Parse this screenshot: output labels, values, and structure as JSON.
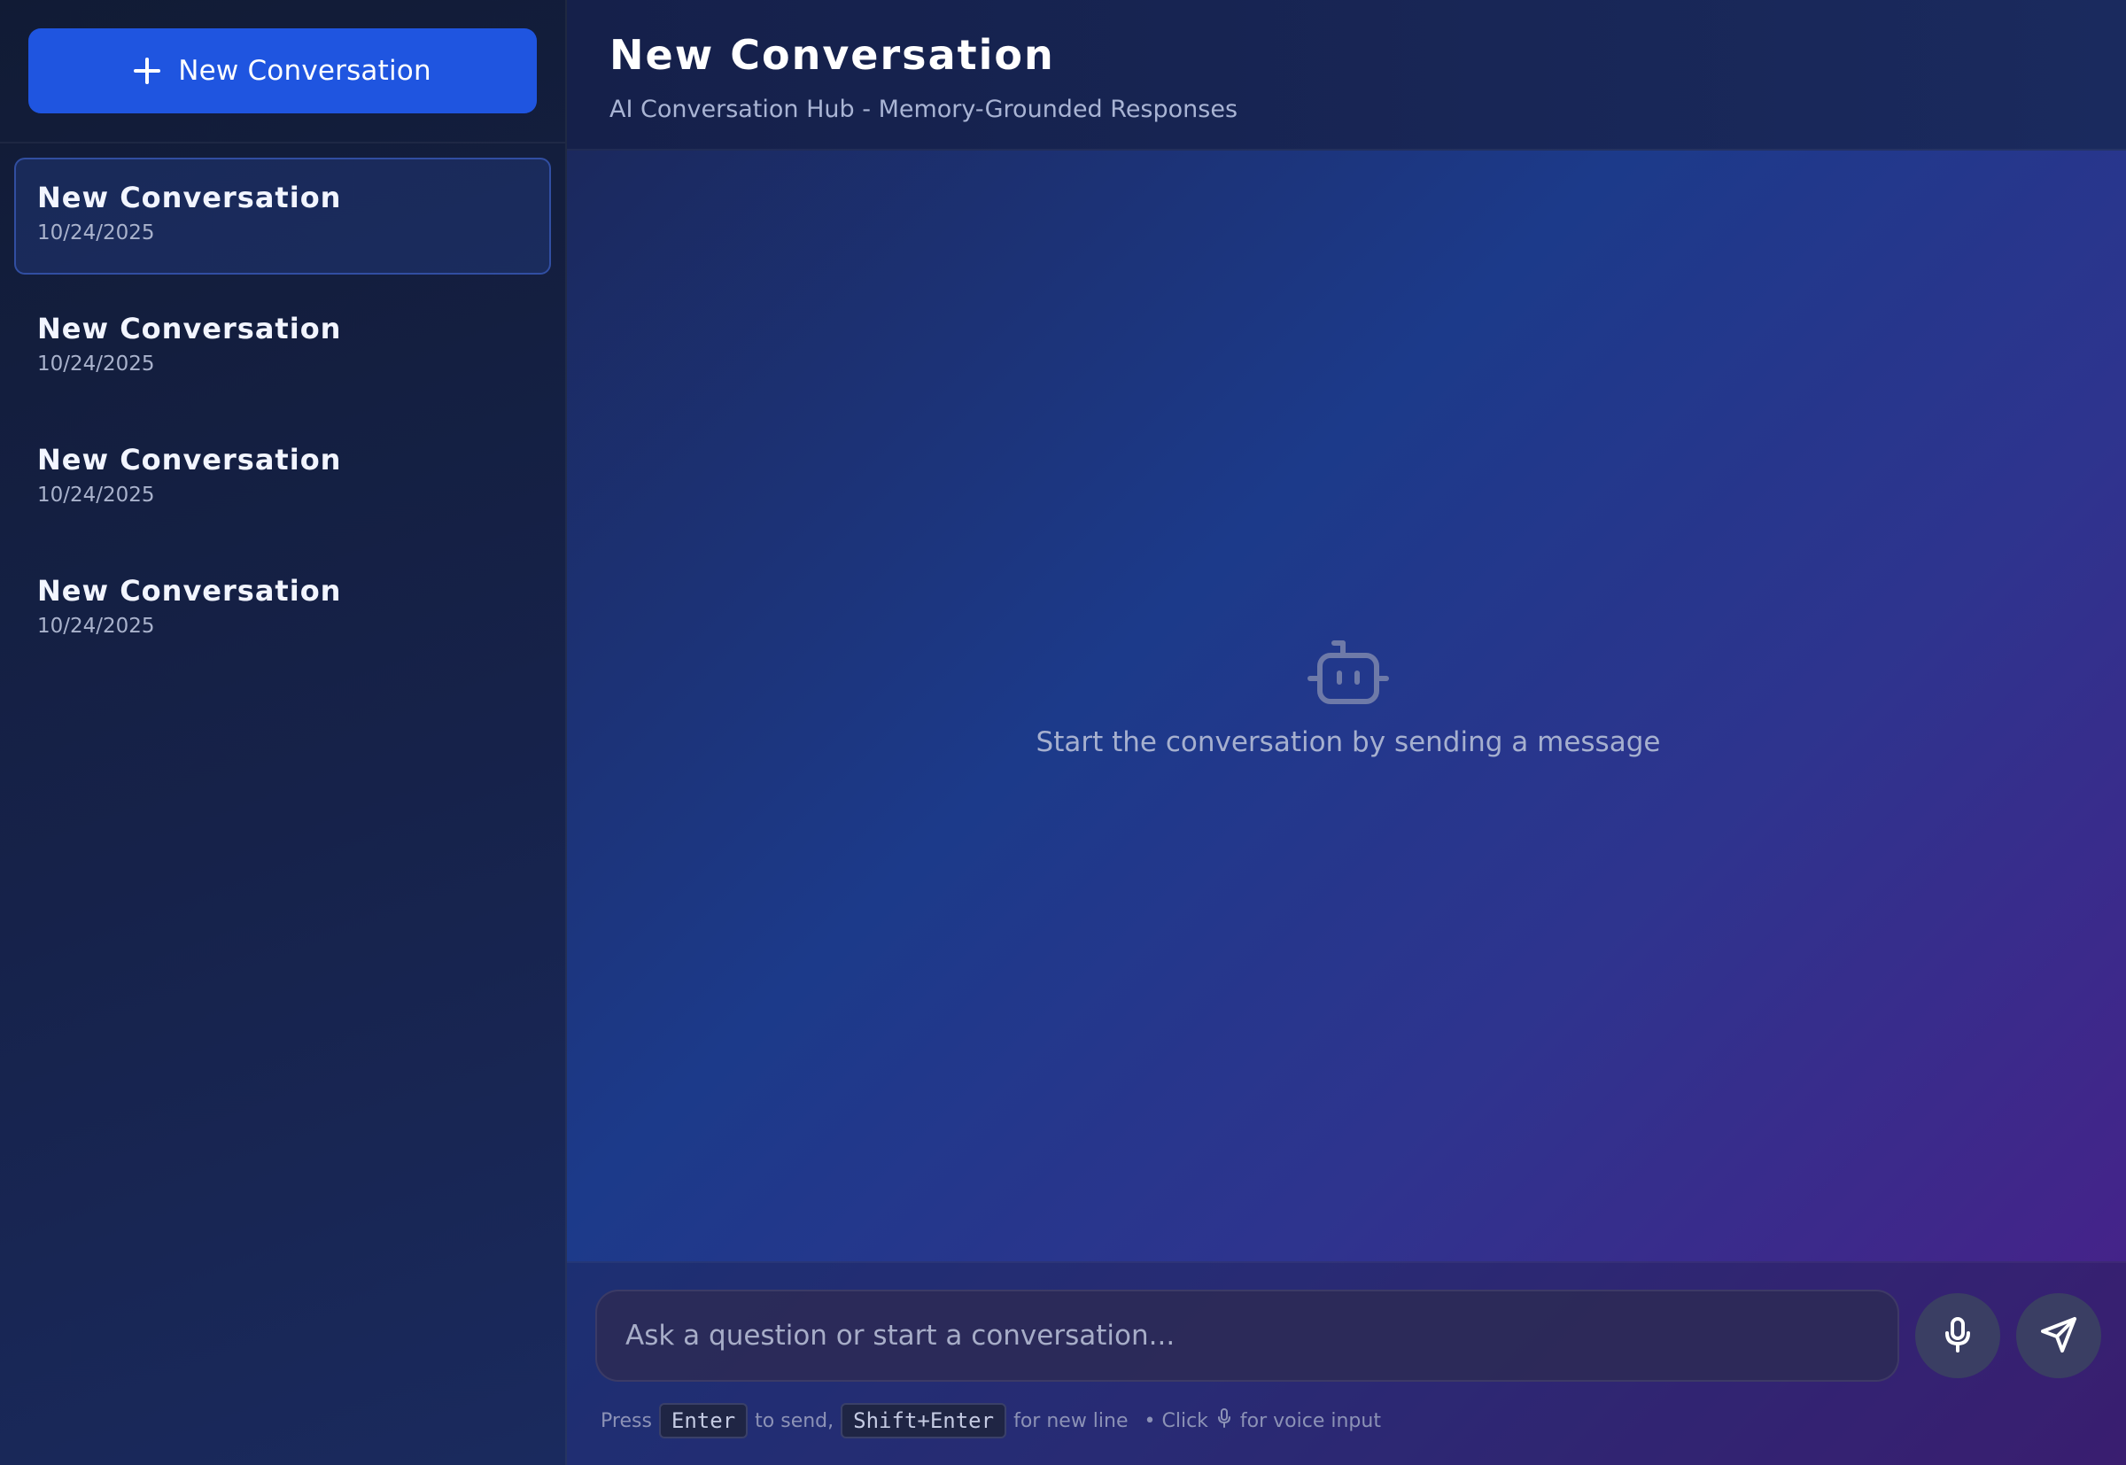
{
  "sidebar": {
    "new_button_label": "New Conversation",
    "items": [
      {
        "title": "New Conversation",
        "date": "10/24/2025",
        "active": true
      },
      {
        "title": "New Conversation",
        "date": "10/24/2025",
        "active": false
      },
      {
        "title": "New Conversation",
        "date": "10/24/2025",
        "active": false
      },
      {
        "title": "New Conversation",
        "date": "10/24/2025",
        "active": false
      }
    ]
  },
  "header": {
    "title": "New Conversation",
    "subtitle": "AI Conversation Hub - Memory-Grounded Responses"
  },
  "chat": {
    "empty_icon": "bot-icon",
    "empty_text": "Start the conversation by sending a message"
  },
  "composer": {
    "placeholder": "Ask a question or start a conversation...",
    "mic_icon": "mic-icon",
    "send_icon": "send-icon",
    "hint": {
      "press": "Press",
      "enter_key": "Enter",
      "to_send": "to send,",
      "shift_enter_key": "Shift+Enter",
      "new_line": "for new line",
      "click": "• Click",
      "voice": "for voice input"
    }
  },
  "colors": {
    "accent": "#1f55e0",
    "sidebar_bg": "#131d3d",
    "active_item_border": "#466edc"
  }
}
